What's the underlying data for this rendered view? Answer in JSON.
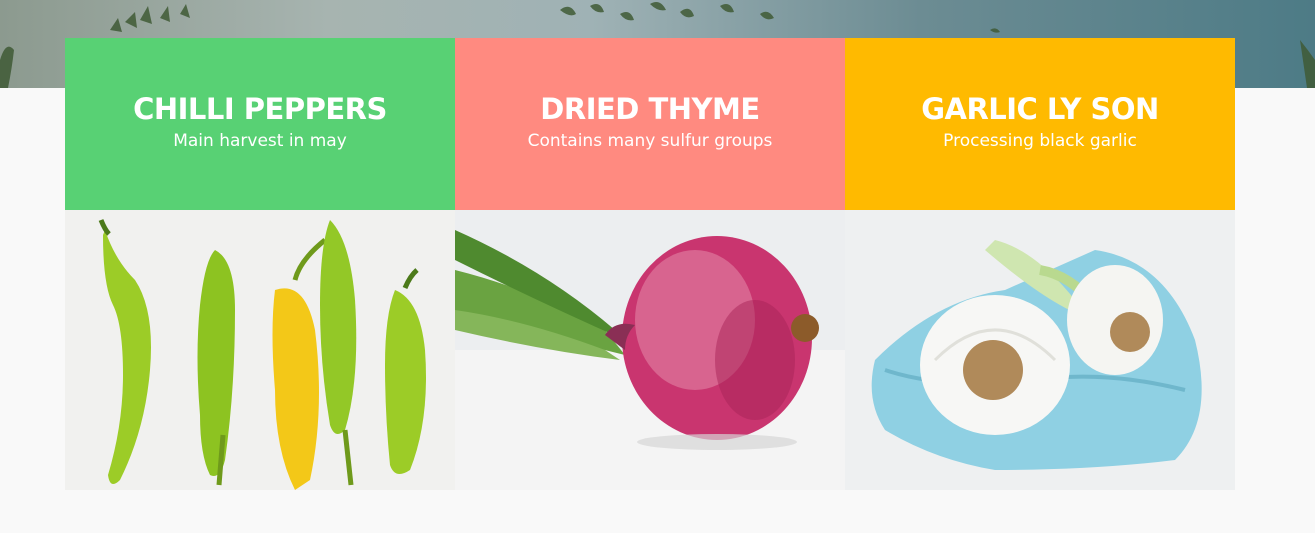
{
  "theme": {
    "green": "#58d174",
    "coral": "#ff8a80",
    "amber": "#ffba00"
  },
  "cards": [
    {
      "title": "CHILLI PEPPERS",
      "subtitle": "Main harvest in may",
      "color": "#58d174",
      "image": "chilli-peppers-photo"
    },
    {
      "title": "DRIED THYME",
      "subtitle": "Contains many sulfur groups",
      "color": "#ff8a80",
      "image": "red-onion-photo"
    },
    {
      "title": "GARLIC LY SON",
      "subtitle": "Processing black garlic",
      "color": "#ffba00",
      "image": "garlic-bulbs-photo"
    }
  ]
}
